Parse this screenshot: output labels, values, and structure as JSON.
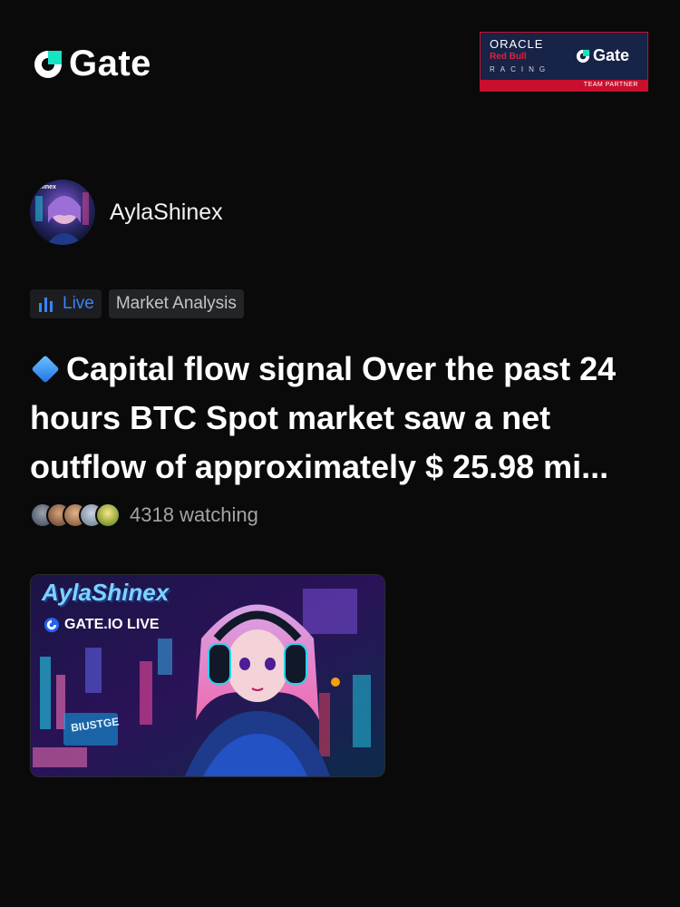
{
  "header": {
    "brand_name": "Gate",
    "partner": {
      "oracle": "ORACLE",
      "redbull": "Red Bull",
      "racing": "RACING",
      "gate": "Gate",
      "strip": "TEAM PARTNER"
    }
  },
  "profile": {
    "username": "AylaShinex",
    "avatar_text": "Shinex"
  },
  "tags": {
    "live_label": "Live",
    "category": "Market Analysis"
  },
  "post": {
    "headline": "Capital flow signal Over the past 24 hours BTC Spot market saw a net outflow of approximately $ 25.98 mi...",
    "watching": "4318 watching"
  },
  "thumbnail": {
    "title": "AylaShinex",
    "badge": "GATE.IO LIVE",
    "sign_1": "BIUSTGE"
  },
  "colors": {
    "accent": "#3b82f6",
    "brand_red": "#c8102e",
    "background": "#0a0a0b"
  }
}
